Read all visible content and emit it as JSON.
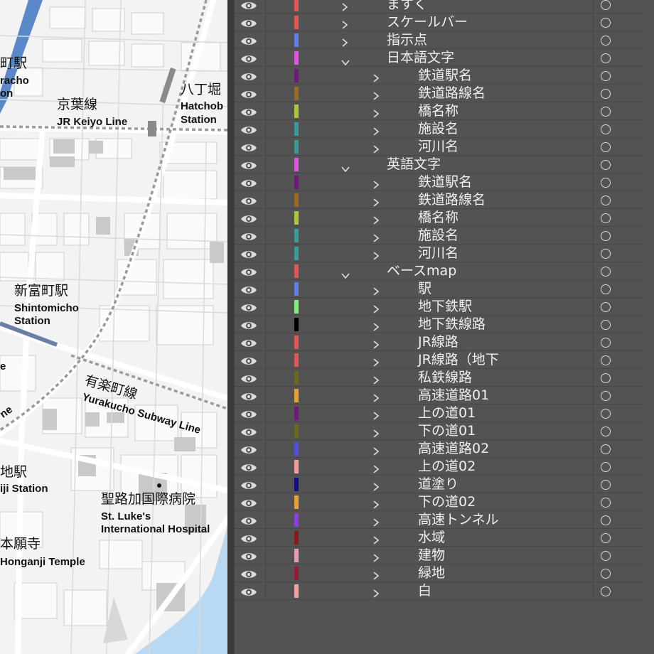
{
  "map": {
    "labels": {
      "hatchobori_jp": "八丁堀",
      "hatchobori_en1": "Hatchob",
      "hatchobori_en2": "Station",
      "keiyo_jp": "京葉線",
      "keiyo_en": "JR Keiyo Line",
      "left_top_jp": "町駅",
      "left_top_en1": "racho",
      "left_top_en2": "on",
      "shintomicho_jp": "新富町駅",
      "shintomicho_en1": "Shintomicho",
      "shintomicho_en2": "Station",
      "yurakucho_jp": "有楽町線",
      "yurakucho_en": "Yurakucho Subway Line",
      "tsukiji_jp": "地駅",
      "tsukiji_en": "iji Station",
      "stluke_jp": "聖路加国際病院",
      "stluke_en1": "St. Luke's",
      "stluke_en2": "International Hospital",
      "honganji_jp": "本願寺",
      "honganji_en": "Honganji Temple",
      "edge_e": "e",
      "edge_ne": "ne"
    }
  },
  "layers": [
    {
      "name": "ますく",
      "color": "#e05555",
      "level": 0,
      "expanded": false
    },
    {
      "name": "スケールバー",
      "color": "#e05555",
      "level": 0,
      "expanded": false
    },
    {
      "name": "指示点",
      "color": "#5b7fe6",
      "level": 0,
      "expanded": false
    },
    {
      "name": "日本語文字",
      "color": "#e055e0",
      "level": 0,
      "expanded": true
    },
    {
      "name": "鉄道駅名",
      "color": "#6e1a7a",
      "level": 1,
      "expanded": false
    },
    {
      "name": "鉄道路線名",
      "color": "#9a6a22",
      "level": 1,
      "expanded": false
    },
    {
      "name": "橋名称",
      "color": "#a8c83a",
      "level": 1,
      "expanded": false
    },
    {
      "name": "施設名",
      "color": "#3a9a9a",
      "level": 1,
      "expanded": false
    },
    {
      "name": "河川名",
      "color": "#3a9a9a",
      "level": 1,
      "expanded": false
    },
    {
      "name": "英語文字",
      "color": "#e055e0",
      "level": 0,
      "expanded": true
    },
    {
      "name": "鉄道駅名",
      "color": "#6e1a7a",
      "level": 1,
      "expanded": false
    },
    {
      "name": "鉄道路線名",
      "color": "#9a6a22",
      "level": 1,
      "expanded": false
    },
    {
      "name": "橋名称",
      "color": "#a8c83a",
      "level": 1,
      "expanded": false
    },
    {
      "name": "施設名",
      "color": "#3a9a9a",
      "level": 1,
      "expanded": false
    },
    {
      "name": "河川名",
      "color": "#3a9a9a",
      "level": 1,
      "expanded": false
    },
    {
      "name": "ベースmap",
      "color": "#e05555",
      "level": 0,
      "expanded": true
    },
    {
      "name": "駅",
      "color": "#5b7fe6",
      "level": 1,
      "expanded": false
    },
    {
      "name": "地下鉄駅",
      "color": "#7ef07e",
      "level": 1,
      "expanded": false
    },
    {
      "name": "地下鉄線路",
      "color": "#000000",
      "level": 1,
      "expanded": false
    },
    {
      "name": "JR線路",
      "color": "#e05555",
      "level": 1,
      "expanded": false
    },
    {
      "name": "JR線路（地下",
      "color": "#e05555",
      "level": 1,
      "expanded": false
    },
    {
      "name": "私鉄線路",
      "color": "#6a6a1a",
      "level": 1,
      "expanded": false
    },
    {
      "name": "高速道路01",
      "color": "#e8a030",
      "level": 1,
      "expanded": false
    },
    {
      "name": "上の道01",
      "color": "#6e1a7a",
      "level": 1,
      "expanded": false
    },
    {
      "name": "下の道01",
      "color": "#6a6a1a",
      "level": 1,
      "expanded": false
    },
    {
      "name": "高速道路02",
      "color": "#5050e0",
      "level": 1,
      "expanded": false
    },
    {
      "name": "上の道02",
      "color": "#f09a9a",
      "level": 1,
      "expanded": false
    },
    {
      "name": "道塗り",
      "color": "#101080",
      "level": 1,
      "expanded": false
    },
    {
      "name": "下の道02",
      "color": "#e8a030",
      "level": 1,
      "expanded": false
    },
    {
      "name": "高速トンネル",
      "color": "#8a40e0",
      "level": 1,
      "expanded": false
    },
    {
      "name": "水域",
      "color": "#8a1a1a",
      "level": 1,
      "expanded": false
    },
    {
      "name": "建物",
      "color": "#e89ab8",
      "level": 1,
      "expanded": false
    },
    {
      "name": "緑地",
      "color": "#9a1a3a",
      "level": 1,
      "expanded": false
    },
    {
      "name": "白",
      "color": "#f0a0a0",
      "level": 1,
      "expanded": false
    }
  ]
}
